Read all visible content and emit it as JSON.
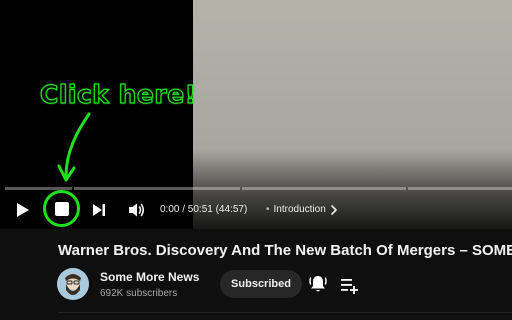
{
  "annotation": {
    "callout_text": "Click here!",
    "color": "#1ee11e"
  },
  "player": {
    "time": "0:00 / 50:51 (44:57)",
    "chapter_separator": "•",
    "chapter": "Introduction",
    "icons": {
      "play": "play-icon",
      "stop": "stop-icon",
      "next": "next-icon",
      "volume": "volume-icon",
      "chapter_chevron": "chevron-right-icon"
    }
  },
  "video": {
    "title": "Warner Bros. Discovery And The New Batch Of Mergers – SOME MORE NEWS"
  },
  "channel": {
    "name": "Some More News",
    "subscribers": "692K subscribers",
    "subscribe_label": "Subscribed",
    "icons": {
      "bell": "bell-icon",
      "playlist_add": "playlist-add-icon",
      "avatar": "avatar"
    }
  }
}
